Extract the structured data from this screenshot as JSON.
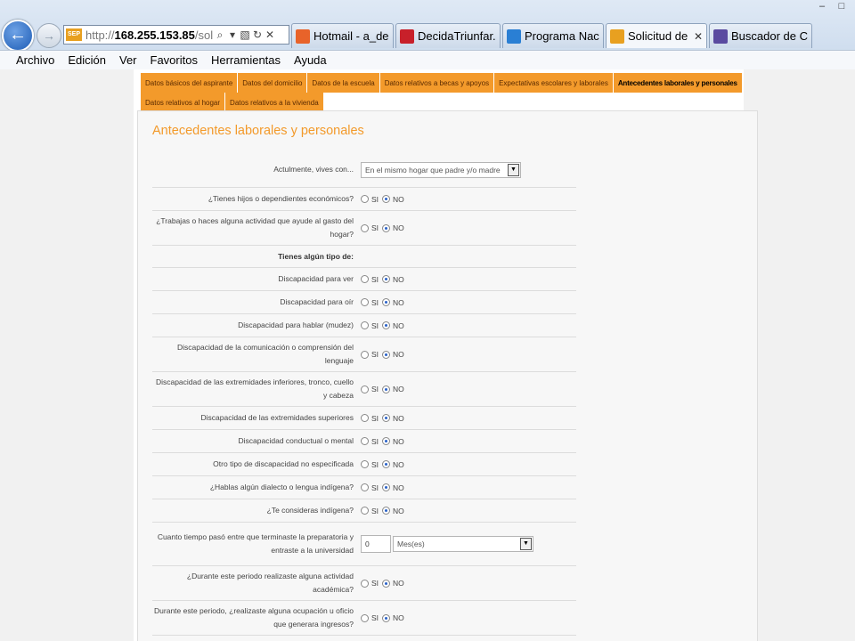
{
  "browser": {
    "window_controls": [
      "–",
      "□"
    ],
    "address": {
      "prefix": "http://",
      "host": "168.255.153.85",
      "path": "/solici"
    },
    "favicon_text": "SEP",
    "tabs": [
      {
        "label": "Hotmail - a_de...",
        "icon": "hotmail-icon",
        "color": "#e8632a",
        "active": false
      },
      {
        "label": "DecidaTriunfar...",
        "icon": "red-cross-icon",
        "color": "#c8202a",
        "active": false
      },
      {
        "label": "Programa Naci...",
        "icon": "ie-icon",
        "color": "#2a7fd4",
        "active": false
      },
      {
        "label": "Solicitud de...",
        "icon": "sep-icon",
        "color": "#e8a020",
        "active": true,
        "close": "✕"
      },
      {
        "label": "Buscador de C...",
        "icon": "search-engine-icon",
        "color": "#5a4aa0",
        "active": false
      }
    ],
    "menu": [
      "Archivo",
      "Edición",
      "Ver",
      "Favoritos",
      "Herramientas",
      "Ayuda"
    ]
  },
  "section_tabs": {
    "row1": [
      {
        "label": "Datos básicos del aspirante",
        "active": false
      },
      {
        "label": "Datos del domicilio",
        "active": false
      },
      {
        "label": "Datos de la escuela",
        "active": false
      },
      {
        "label": "Datos relativos a becas y apoyos",
        "active": false
      },
      {
        "label": "Expectativas escolares y laborales",
        "active": false
      },
      {
        "label": "Antecedentes laborales y personales",
        "active": true
      }
    ],
    "row2": [
      {
        "label": "Datos relativos al hogar",
        "active": false
      },
      {
        "label": "Datos relativos a la vivienda",
        "active": false
      }
    ]
  },
  "panel": {
    "title": "Antecedentes laborales y personales"
  },
  "form": {
    "rows": [
      {
        "label": "Actulmente, vives con...",
        "type": "select",
        "value": "En el mismo hogar que padre y/o madre",
        "height": 40
      },
      {
        "label": "¿Tienes hijos o dependientes económicos?",
        "type": "radio",
        "options": [
          "SI",
          "NO"
        ],
        "selected": "NO",
        "height": 26
      },
      {
        "label": "¿Trabajas o haces alguna actividad que ayude al gasto del hogar?",
        "type": "radio",
        "options": [
          "SI",
          "NO"
        ],
        "selected": "NO",
        "height": 39
      },
      {
        "label": "Tienes algún tipo de:",
        "type": "heading",
        "height": 25
      },
      {
        "label": "Discapacidad para ver",
        "type": "radio",
        "options": [
          "SI",
          "NO"
        ],
        "selected": "NO",
        "height": 26
      },
      {
        "label": "Discapacidad para oír",
        "type": "radio",
        "options": [
          "SI",
          "NO"
        ],
        "selected": "NO",
        "height": 26
      },
      {
        "label": "Discapacidad para hablar (mudez)",
        "type": "radio",
        "options": [
          "SI",
          "NO"
        ],
        "selected": "NO",
        "height": 26
      },
      {
        "label": "Discapacidad de la comunicación o comprensión del lenguaje",
        "type": "radio",
        "options": [
          "SI",
          "NO"
        ],
        "selected": "NO",
        "height": 39
      },
      {
        "label": "Discapacidad de las extremidades inferiores, tronco, cuello y cabeza",
        "type": "radio",
        "options": [
          "SI",
          "NO"
        ],
        "selected": "NO",
        "height": 39
      },
      {
        "label": "Discapacidad de las extremidades superiores",
        "type": "radio",
        "options": [
          "SI",
          "NO"
        ],
        "selected": "NO",
        "height": 26
      },
      {
        "label": "Discapacidad conductual o mental",
        "type": "radio",
        "options": [
          "SI",
          "NO"
        ],
        "selected": "NO",
        "height": 26
      },
      {
        "label": "Otro tipo de discapacidad no especificada",
        "type": "radio",
        "options": [
          "SI",
          "NO"
        ],
        "selected": "NO",
        "height": 26
      },
      {
        "label": "¿Hablas algún dialecto o lengua indígena?",
        "type": "radio",
        "options": [
          "SI",
          "NO"
        ],
        "selected": "NO",
        "height": 26
      },
      {
        "label": "¿Te consideras indígena?",
        "type": "radio",
        "options": [
          "SI",
          "NO"
        ],
        "selected": "NO",
        "height": 26
      },
      {
        "label": "Cuanto tiempo pasó entre que terminaste la preparatoria y entraste a la universidad",
        "type": "number-select",
        "number": "0",
        "value": "Mes(es)",
        "height": 49
      },
      {
        "label": "¿Durante este periodo realizaste alguna actividad académica?",
        "type": "radio",
        "options": [
          "SI",
          "NO"
        ],
        "selected": "NO",
        "height": 39
      },
      {
        "label": "Durante este periodo, ¿realizaste alguna ocupación u oficio que generara ingresos?",
        "type": "radio",
        "options": [
          "SI",
          "NO"
        ],
        "selected": "NO",
        "height": 39
      }
    ]
  },
  "colors": {
    "accent": "#f39a2b",
    "active_tab_text": "#000000"
  }
}
